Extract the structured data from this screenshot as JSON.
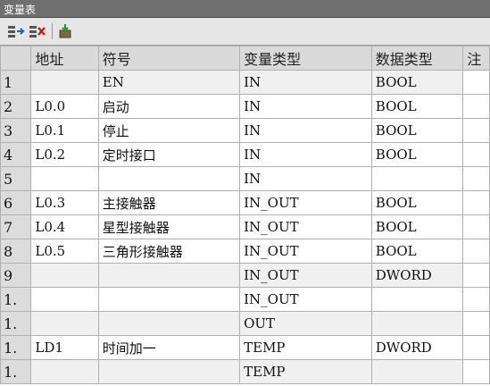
{
  "window": {
    "title": "变量表"
  },
  "toolbar": {
    "icons": [
      "insert-row-icon",
      "delete-row-icon",
      "update-icon"
    ]
  },
  "table": {
    "headers": [
      "",
      "地址",
      "符号",
      "变量类型",
      "数据类型",
      "注"
    ],
    "rows": [
      {
        "num": "1",
        "address": "",
        "symbol": "EN",
        "var_type": "IN",
        "data_type": "BOOL"
      },
      {
        "num": "2",
        "address": "L0.0",
        "symbol": "启动",
        "var_type": "IN",
        "data_type": "BOOL"
      },
      {
        "num": "3",
        "address": "L0.1",
        "symbol": "停止",
        "var_type": "IN",
        "data_type": "BOOL"
      },
      {
        "num": "4",
        "address": "L0.2",
        "symbol": "定时接口",
        "var_type": "IN",
        "data_type": "BOOL"
      },
      {
        "num": "5",
        "address": "",
        "symbol": "",
        "var_type": "IN",
        "data_type": ""
      },
      {
        "num": "6",
        "address": "L0.3",
        "symbol": "主接触器",
        "var_type": "IN_OUT",
        "data_type": "BOOL"
      },
      {
        "num": "7",
        "address": "L0.4",
        "symbol": "星型接触器",
        "var_type": "IN_OUT",
        "data_type": "BOOL"
      },
      {
        "num": "8",
        "address": "L0.5",
        "symbol": "三角形接触器",
        "var_type": "IN_OUT",
        "data_type": "BOOL"
      },
      {
        "num": "9",
        "address": "",
        "symbol": "",
        "var_type": "IN_OUT",
        "data_type": "DWORD"
      },
      {
        "num": "1.",
        "address": "",
        "symbol": "",
        "var_type": "IN_OUT",
        "data_type": ""
      },
      {
        "num": "1.",
        "address": "",
        "symbol": "",
        "var_type": "OUT",
        "data_type": ""
      },
      {
        "num": "1.",
        "address": "LD1",
        "symbol": "时间加一",
        "var_type": "TEMP",
        "data_type": "DWORD"
      },
      {
        "num": "1.",
        "address": "",
        "symbol": "",
        "var_type": "TEMP",
        "data_type": ""
      }
    ]
  },
  "colors": {
    "gray_cell": "#f0f0f0",
    "header_bg": "#dadada",
    "title_bg": "#6f6f6f"
  }
}
